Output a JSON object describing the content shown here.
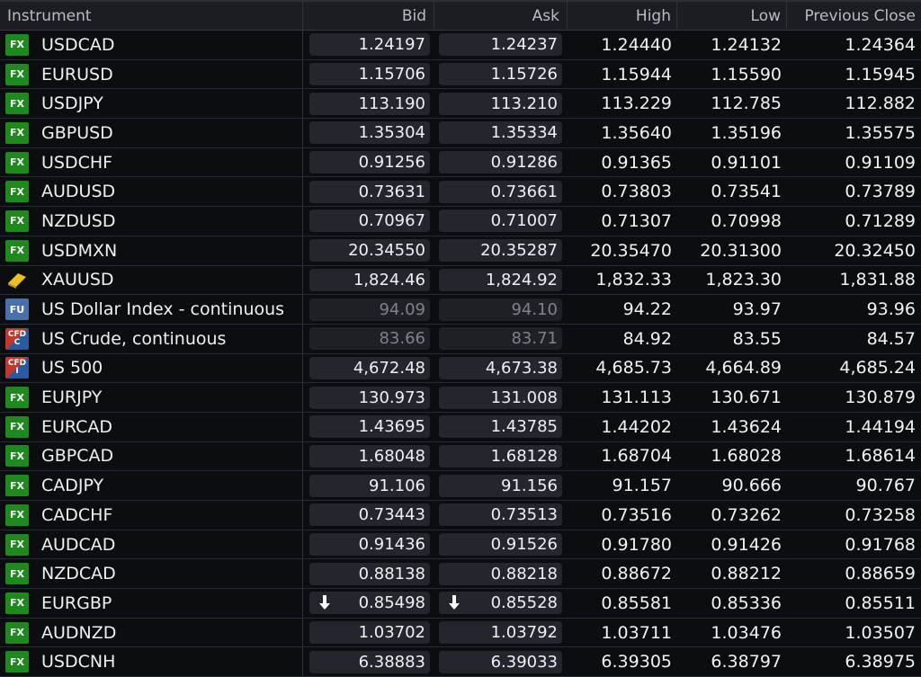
{
  "columns": {
    "instrument": "Instrument",
    "bid": "Bid",
    "ask": "Ask",
    "high": "High",
    "low": "Low",
    "prev": "Previous Close"
  },
  "colors": {
    "fx_badge": "#1e8a1e",
    "fu_badge": "#4b6fa8",
    "cfd_red": "#c0392b",
    "cfd_blue": "#2c5aa0",
    "gold": "#e8c21a"
  },
  "rows": [
    {
      "badge": "FX",
      "icon": "fx-icon",
      "name": "USDCAD",
      "bid": "1.24197",
      "ask": "1.24237",
      "high": "1.24440",
      "low": "1.24132",
      "prev": "1.24364"
    },
    {
      "badge": "FX",
      "icon": "fx-icon",
      "name": "EURUSD",
      "bid": "1.15706",
      "ask": "1.15726",
      "high": "1.15944",
      "low": "1.15590",
      "prev": "1.15945"
    },
    {
      "badge": "FX",
      "icon": "fx-icon",
      "name": "USDJPY",
      "bid": "113.190",
      "ask": "113.210",
      "high": "113.229",
      "low": "112.785",
      "prev": "112.882"
    },
    {
      "badge": "FX",
      "icon": "fx-icon",
      "name": "GBPUSD",
      "bid": "1.35304",
      "ask": "1.35334",
      "high": "1.35640",
      "low": "1.35196",
      "prev": "1.35575"
    },
    {
      "badge": "FX",
      "icon": "fx-icon",
      "name": "USDCHF",
      "bid": "0.91256",
      "ask": "0.91286",
      "high": "0.91365",
      "low": "0.91101",
      "prev": "0.91109"
    },
    {
      "badge": "FX",
      "icon": "fx-icon",
      "name": "AUDUSD",
      "bid": "0.73631",
      "ask": "0.73661",
      "high": "0.73803",
      "low": "0.73541",
      "prev": "0.73789"
    },
    {
      "badge": "FX",
      "icon": "fx-icon",
      "name": "NZDUSD",
      "bid": "0.70967",
      "ask": "0.71007",
      "high": "0.71307",
      "low": "0.70998",
      "prev": "0.71289"
    },
    {
      "badge": "FX",
      "icon": "fx-icon",
      "name": "USDMXN",
      "bid": "20.34550",
      "ask": "20.35287",
      "high": "20.35470",
      "low": "20.31300",
      "prev": "20.32450"
    },
    {
      "badge": "",
      "icon": "gold-bar-icon",
      "name": "XAUUSD",
      "bid": "1,824.46",
      "ask": "1,824.92",
      "high": "1,832.33",
      "low": "1,823.30",
      "prev": "1,831.88"
    },
    {
      "badge": "FU",
      "icon": "futures-icon",
      "name": "US Dollar Index - continuous",
      "bid": "94.09",
      "ask": "94.10",
      "high": "94.22",
      "low": "93.97",
      "prev": "93.96",
      "dim": true
    },
    {
      "badge": "CFD C",
      "icon": "cfd-commodity-icon",
      "name": "US Crude, continuous",
      "bid": "83.66",
      "ask": "83.71",
      "high": "84.92",
      "low": "83.55",
      "prev": "84.57",
      "dim": true
    },
    {
      "badge": "CFD I",
      "icon": "cfd-index-icon",
      "name": "US 500",
      "bid": "4,672.48",
      "ask": "4,673.38",
      "high": "4,685.73",
      "low": "4,664.89",
      "prev": "4,685.24"
    },
    {
      "badge": "FX",
      "icon": "fx-icon",
      "name": "EURJPY",
      "bid": "130.973",
      "ask": "131.008",
      "high": "131.113",
      "low": "130.671",
      "prev": "130.879"
    },
    {
      "badge": "FX",
      "icon": "fx-icon",
      "name": "EURCAD",
      "bid": "1.43695",
      "ask": "1.43785",
      "high": "1.44202",
      "low": "1.43624",
      "prev": "1.44194"
    },
    {
      "badge": "FX",
      "icon": "fx-icon",
      "name": "GBPCAD",
      "bid": "1.68048",
      "ask": "1.68128",
      "high": "1.68704",
      "low": "1.68028",
      "prev": "1.68614"
    },
    {
      "badge": "FX",
      "icon": "fx-icon",
      "name": "CADJPY",
      "bid": "91.106",
      "ask": "91.156",
      "high": "91.157",
      "low": "90.666",
      "prev": "90.767"
    },
    {
      "badge": "FX",
      "icon": "fx-icon",
      "name": "CADCHF",
      "bid": "0.73443",
      "ask": "0.73513",
      "high": "0.73516",
      "low": "0.73262",
      "prev": "0.73258"
    },
    {
      "badge": "FX",
      "icon": "fx-icon",
      "name": "AUDCAD",
      "bid": "0.91436",
      "ask": "0.91526",
      "high": "0.91780",
      "low": "0.91426",
      "prev": "0.91768"
    },
    {
      "badge": "FX",
      "icon": "fx-icon",
      "name": "NZDCAD",
      "bid": "0.88138",
      "ask": "0.88218",
      "high": "0.88672",
      "low": "0.88212",
      "prev": "0.88659"
    },
    {
      "badge": "FX",
      "icon": "fx-icon",
      "name": "EURGBP",
      "bid": "0.85498",
      "ask": "0.85528",
      "high": "0.85581",
      "low": "0.85336",
      "prev": "0.85511",
      "arrow": "arrow-down-icon"
    },
    {
      "badge": "FX",
      "icon": "fx-icon",
      "name": "AUDNZD",
      "bid": "1.03702",
      "ask": "1.03792",
      "high": "1.03711",
      "low": "1.03476",
      "prev": "1.03507"
    },
    {
      "badge": "FX",
      "icon": "fx-icon",
      "name": "USDCNH",
      "bid": "6.38883",
      "ask": "6.39033",
      "high": "6.39305",
      "low": "6.38797",
      "prev": "6.38975"
    }
  ]
}
